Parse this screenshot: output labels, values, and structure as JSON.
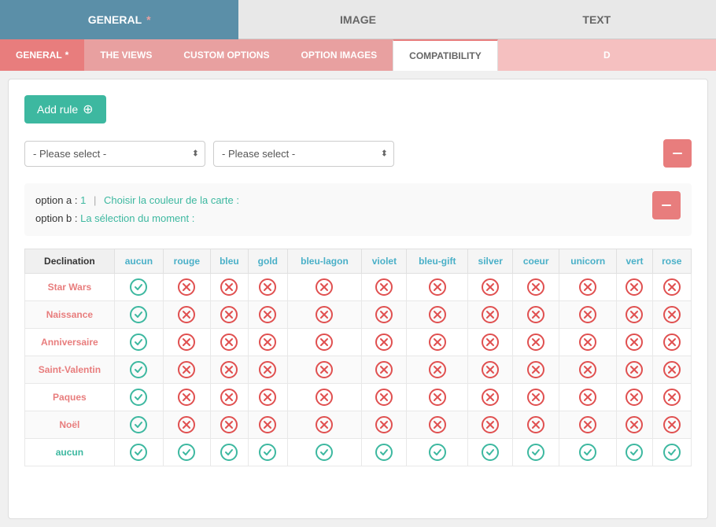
{
  "top_tabs": [
    {
      "id": "general",
      "label": "GENERAL",
      "has_asterisk": true,
      "active": true
    },
    {
      "id": "image",
      "label": "IMAGE",
      "has_asterisk": false,
      "active": false
    },
    {
      "id": "text",
      "label": "TEXT",
      "has_asterisk": false,
      "active": false
    }
  ],
  "sub_tabs": [
    {
      "id": "general",
      "label": "GENERAL",
      "has_asterisk": true,
      "style": "active-coral"
    },
    {
      "id": "the-views",
      "label": "THE VIEWS",
      "has_asterisk": false,
      "style": "inactive-pink"
    },
    {
      "id": "custom-options",
      "label": "CUSTOM OPTIONS",
      "has_asterisk": false,
      "style": "inactive-pink"
    },
    {
      "id": "option-images",
      "label": "OPTION IMAGES",
      "has_asterisk": false,
      "style": "inactive-pink"
    },
    {
      "id": "compatibility",
      "label": "COMPATIBILITY",
      "has_asterisk": false,
      "style": "active-compat"
    },
    {
      "id": "more",
      "label": "D",
      "has_asterisk": false,
      "style": "right-cut"
    }
  ],
  "add_rule_label": "Add rule",
  "select1_placeholder": "- Please select -",
  "select2_placeholder": "- Please select -",
  "info": {
    "option_a_label": "option a",
    "option_a_value": "1",
    "option_a_desc": "Choisir la couleur de la carte :",
    "option_b_label": "option b",
    "option_b_desc": "La sélection du moment :"
  },
  "table": {
    "header_col": "Declination",
    "columns": [
      "aucun",
      "rouge",
      "bleu",
      "gold",
      "bleu-lagon",
      "violet",
      "bleu-gift",
      "silver",
      "coeur",
      "unicorn",
      "vert",
      "rose"
    ],
    "rows": [
      {
        "label": "Star Wars",
        "color": "orange",
        "values": [
          true,
          false,
          false,
          false,
          false,
          false,
          false,
          false,
          false,
          false,
          false,
          false
        ]
      },
      {
        "label": "Naissance",
        "color": "orange",
        "values": [
          true,
          false,
          false,
          false,
          false,
          false,
          false,
          false,
          false,
          false,
          false,
          false
        ]
      },
      {
        "label": "Anniversaire",
        "color": "orange",
        "values": [
          true,
          false,
          false,
          false,
          false,
          false,
          false,
          false,
          false,
          false,
          false,
          false
        ]
      },
      {
        "label": "Saint-Valentin",
        "color": "orange",
        "values": [
          true,
          false,
          false,
          false,
          false,
          false,
          false,
          false,
          false,
          false,
          false,
          false
        ]
      },
      {
        "label": "Paques",
        "color": "orange",
        "values": [
          true,
          false,
          false,
          false,
          false,
          false,
          false,
          false,
          false,
          false,
          false,
          false
        ]
      },
      {
        "label": "Noël",
        "color": "orange",
        "values": [
          true,
          false,
          false,
          false,
          false,
          false,
          false,
          false,
          false,
          false,
          false,
          false
        ]
      },
      {
        "label": "aucun",
        "color": "green",
        "values": [
          true,
          true,
          true,
          true,
          true,
          true,
          true,
          true,
          true,
          true,
          true,
          true
        ]
      }
    ]
  },
  "colors": {
    "teal": "#3db8a0",
    "coral": "#e87d7d",
    "blue_header": "#5b8fa8",
    "col_header_blue": "#4ab0c8",
    "orange_label": "#e87d7d",
    "green_label": "#3db8a0"
  }
}
